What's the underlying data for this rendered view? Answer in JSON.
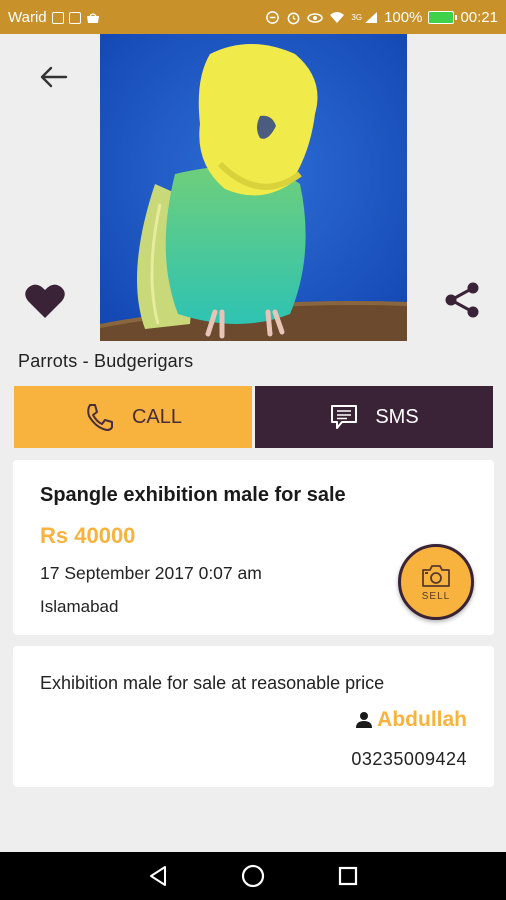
{
  "status_bar": {
    "carrier": "Warid",
    "battery": "100%",
    "time": "00:21",
    "network": "3G",
    "background_color": "#c8912a"
  },
  "listing": {
    "category": "Parrots - Budgerigars",
    "title": "Spangle exhibition male for sale",
    "price": "Rs 40000",
    "date": "17 September 2017 0:07 am",
    "city": "Islamabad",
    "description": "Exhibition male for sale at reasonable price",
    "seller_name": "Abdullah",
    "seller_phone": "03235009424"
  },
  "actions": {
    "call_label": "CALL",
    "sms_label": "SMS",
    "sell_label": "SELL"
  },
  "icons": {
    "back": "arrow-left-icon",
    "favorite": "heart-icon",
    "share": "share-icon",
    "call": "phone-icon",
    "sms": "message-icon",
    "sell": "camera-icon",
    "seller": "person-icon"
  },
  "colors": {
    "accent": "#f7b33e",
    "dark": "#3a2336",
    "background": "#eeeeee"
  }
}
